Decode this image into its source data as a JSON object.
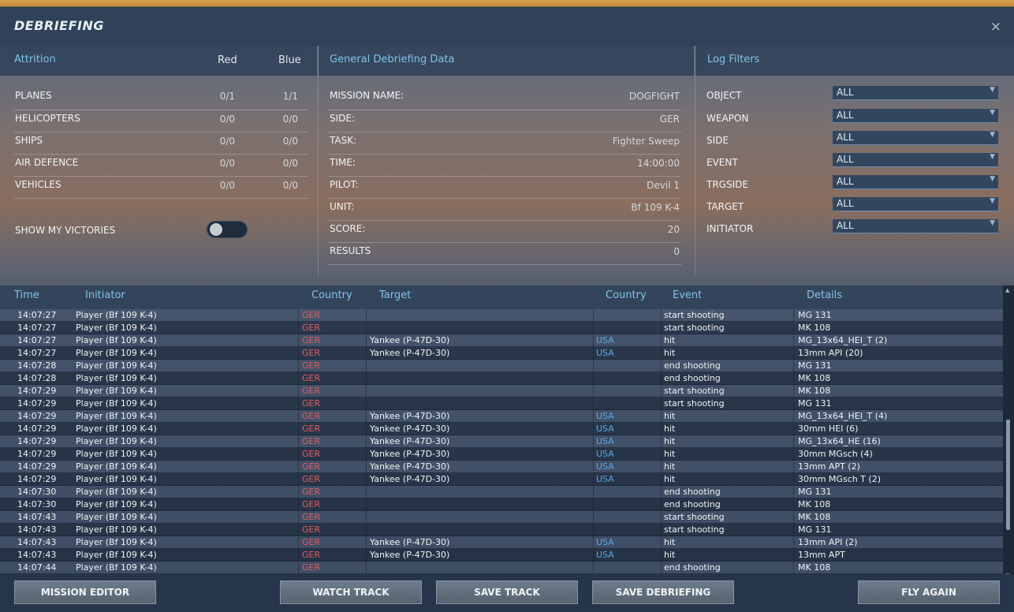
{
  "window": {
    "title": "DEBRIEFING",
    "close_glyph": "×"
  },
  "attrition": {
    "title": "Attrition",
    "col_red": "Red",
    "col_blue": "Blue",
    "rows": [
      {
        "label": "PLANES",
        "red": "0/1",
        "blue": "1/1"
      },
      {
        "label": "HELICOPTERS",
        "red": "0/0",
        "blue": "0/0"
      },
      {
        "label": "SHIPS",
        "red": "0/0",
        "blue": "0/0"
      },
      {
        "label": "AIR DEFENCE",
        "red": "0/0",
        "blue": "0/0"
      },
      {
        "label": "VEHICLES",
        "red": "0/0",
        "blue": "0/0"
      }
    ],
    "show_victories_label": "SHOW MY VICTORIES",
    "show_victories_on": false
  },
  "general": {
    "title": "General Debriefing Data",
    "rows": [
      {
        "label": "MISSION NAME:",
        "value": "DOGFIGHT"
      },
      {
        "label": "SIDE:",
        "value": "GER"
      },
      {
        "label": "TASK:",
        "value": "Fighter Sweep"
      },
      {
        "label": "TIME:",
        "value": "14:00:00"
      },
      {
        "label": "PILOT:",
        "value": "Devil 1"
      },
      {
        "label": "UNIT:",
        "value": "Bf 109 K-4"
      },
      {
        "label": "SCORE:",
        "value": "20"
      },
      {
        "label": "RESULTS",
        "value": "0"
      }
    ]
  },
  "filters": {
    "title": "Log Filters",
    "rows": [
      {
        "label": "OBJECT",
        "value": "ALL"
      },
      {
        "label": "WEAPON",
        "value": "ALL"
      },
      {
        "label": "SIDE",
        "value": "ALL"
      },
      {
        "label": "EVENT",
        "value": "ALL"
      },
      {
        "label": "TRGSIDE",
        "value": "ALL"
      },
      {
        "label": "TARGET",
        "value": "ALL"
      },
      {
        "label": "INITIATOR",
        "value": "ALL"
      }
    ]
  },
  "log": {
    "headers": {
      "time": "Time",
      "initiator": "Initiator",
      "country": "Country",
      "target": "Target",
      "target_country": "Country",
      "event": "Event",
      "details": "Details"
    },
    "rows": [
      {
        "time": "14:07:27",
        "initiator": "Player (Bf 109 K-4)",
        "country": "GER",
        "target": "",
        "target_country": "",
        "event": "start shooting",
        "details": "MG 131"
      },
      {
        "time": "14:07:27",
        "initiator": "Player (Bf 109 K-4)",
        "country": "GER",
        "target": "",
        "target_country": "",
        "event": "start shooting",
        "details": "MK 108"
      },
      {
        "time": "14:07:27",
        "initiator": "Player (Bf 109 K-4)",
        "country": "GER",
        "target": "Yankee (P-47D-30)",
        "target_country": "USA",
        "event": "hit",
        "details": "MG_13x64_HEI_T (2)"
      },
      {
        "time": "14:07:27",
        "initiator": "Player (Bf 109 K-4)",
        "country": "GER",
        "target": "Yankee (P-47D-30)",
        "target_country": "USA",
        "event": "hit",
        "details": "13mm API (20)"
      },
      {
        "time": "14:07:28",
        "initiator": "Player (Bf 109 K-4)",
        "country": "GER",
        "target": "",
        "target_country": "",
        "event": "end shooting",
        "details": "MG 131"
      },
      {
        "time": "14:07:28",
        "initiator": "Player (Bf 109 K-4)",
        "country": "GER",
        "target": "",
        "target_country": "",
        "event": "end shooting",
        "details": "MK 108"
      },
      {
        "time": "14:07:29",
        "initiator": "Player (Bf 109 K-4)",
        "country": "GER",
        "target": "",
        "target_country": "",
        "event": "start shooting",
        "details": "MK 108"
      },
      {
        "time": "14:07:29",
        "initiator": "Player (Bf 109 K-4)",
        "country": "GER",
        "target": "",
        "target_country": "",
        "event": "start shooting",
        "details": "MG 131"
      },
      {
        "time": "14:07:29",
        "initiator": "Player (Bf 109 K-4)",
        "country": "GER",
        "target": "Yankee (P-47D-30)",
        "target_country": "USA",
        "event": "hit",
        "details": "MG_13x64_HEI_T (4)"
      },
      {
        "time": "14:07:29",
        "initiator": "Player (Bf 109 K-4)",
        "country": "GER",
        "target": "Yankee (P-47D-30)",
        "target_country": "USA",
        "event": "hit",
        "details": "30mm HEI (6)"
      },
      {
        "time": "14:07:29",
        "initiator": "Player (Bf 109 K-4)",
        "country": "GER",
        "target": "Yankee (P-47D-30)",
        "target_country": "USA",
        "event": "hit",
        "details": "MG_13x64_HE (16)"
      },
      {
        "time": "14:07:29",
        "initiator": "Player (Bf 109 K-4)",
        "country": "GER",
        "target": "Yankee (P-47D-30)",
        "target_country": "USA",
        "event": "hit",
        "details": "30mm MGsch (4)"
      },
      {
        "time": "14:07:29",
        "initiator": "Player (Bf 109 K-4)",
        "country": "GER",
        "target": "Yankee (P-47D-30)",
        "target_country": "USA",
        "event": "hit",
        "details": "13mm APT (2)"
      },
      {
        "time": "14:07:29",
        "initiator": "Player (Bf 109 K-4)",
        "country": "GER",
        "target": "Yankee (P-47D-30)",
        "target_country": "USA",
        "event": "hit",
        "details": "30mm MGsch T (2)"
      },
      {
        "time": "14:07:30",
        "initiator": "Player (Bf 109 K-4)",
        "country": "GER",
        "target": "",
        "target_country": "",
        "event": "end shooting",
        "details": "MG 131"
      },
      {
        "time": "14:07:30",
        "initiator": "Player (Bf 109 K-4)",
        "country": "GER",
        "target": "",
        "target_country": "",
        "event": "end shooting",
        "details": "MK 108"
      },
      {
        "time": "14:07:43",
        "initiator": "Player (Bf 109 K-4)",
        "country": "GER",
        "target": "",
        "target_country": "",
        "event": "start shooting",
        "details": "MK 108"
      },
      {
        "time": "14:07:43",
        "initiator": "Player (Bf 109 K-4)",
        "country": "GER",
        "target": "",
        "target_country": "",
        "event": "start shooting",
        "details": "MG 131"
      },
      {
        "time": "14:07:43",
        "initiator": "Player (Bf 109 K-4)",
        "country": "GER",
        "target": "Yankee (P-47D-30)",
        "target_country": "USA",
        "event": "hit",
        "details": "13mm API (2)"
      },
      {
        "time": "14:07:43",
        "initiator": "Player (Bf 109 K-4)",
        "country": "GER",
        "target": "Yankee (P-47D-30)",
        "target_country": "USA",
        "event": "hit",
        "details": "13mm APT"
      },
      {
        "time": "14:07:44",
        "initiator": "Player (Bf 109 K-4)",
        "country": "GER",
        "target": "",
        "target_country": "",
        "event": "end shooting",
        "details": "MK 108"
      }
    ]
  },
  "footer": {
    "mission_editor": "MISSION EDITOR",
    "watch_track": "WATCH TRACK",
    "save_track": "SAVE TRACK",
    "save_debriefing": "SAVE DEBRIEFING",
    "fly_again": "FLY AGAIN"
  },
  "colors": {
    "accent": "#7fc3ea",
    "red_side": "#e25c5c",
    "blue_side": "#56a8e4"
  }
}
